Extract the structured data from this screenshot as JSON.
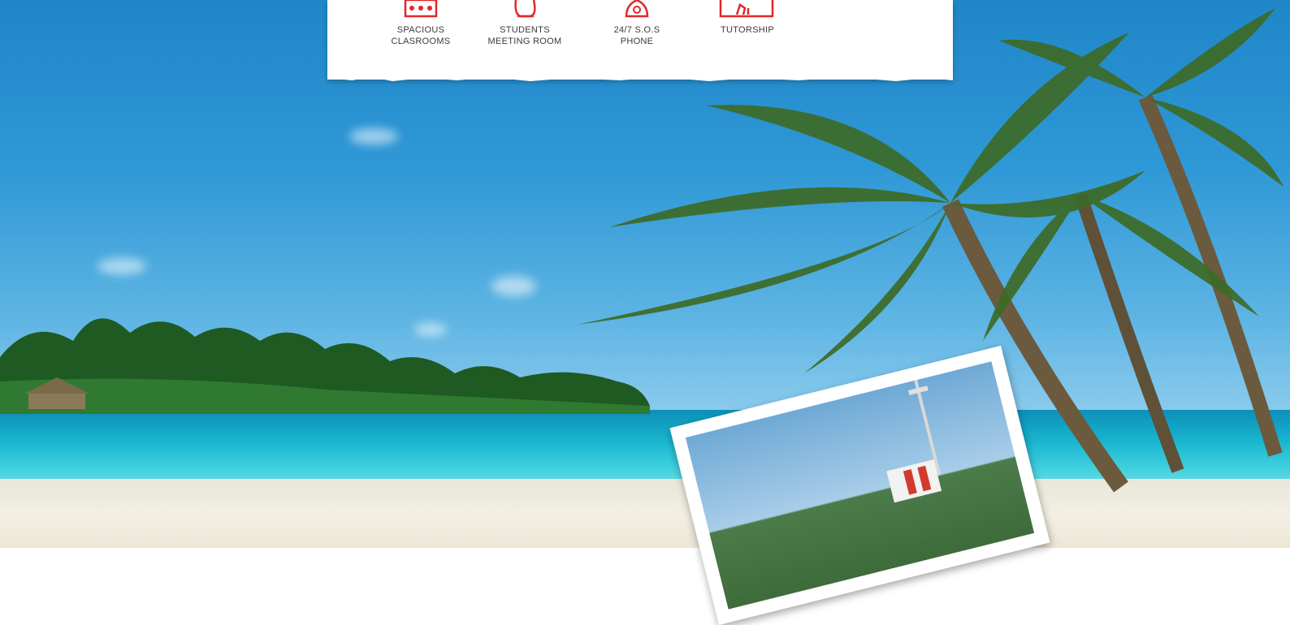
{
  "features": [
    {
      "icon": "classroom-icon",
      "label": "SPACIOUS\nCLASROOMS"
    },
    {
      "icon": "meeting-room-icon",
      "label": "STUDENTS\nMEETING ROOM"
    },
    {
      "icon": "phone-icon",
      "label": "24/7 S.O.S\nPHONE"
    },
    {
      "icon": "tutorship-icon",
      "label": "TUTORSHIP"
    }
  ],
  "colors": {
    "accent": "#e3262b",
    "label_text": "#3a3a3a",
    "card_bg": "#ffffff"
  }
}
